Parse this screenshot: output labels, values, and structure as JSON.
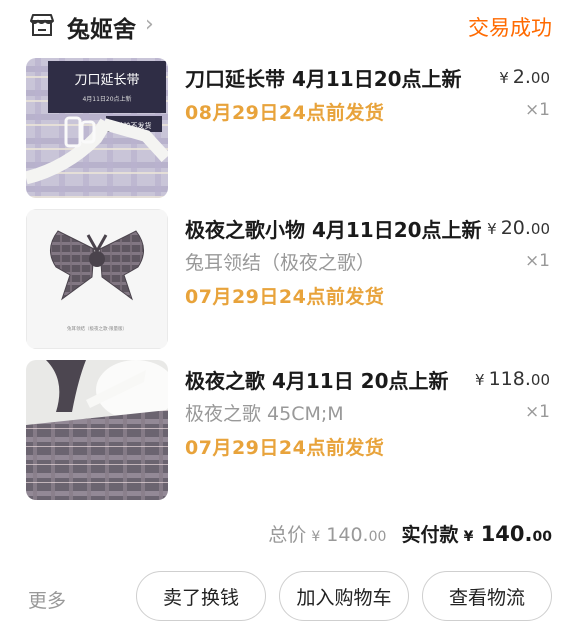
{
  "shop": {
    "name": "兔姬舍",
    "status": "交易成功"
  },
  "items": [
    {
      "title": "刀口延长带  4月11日20点上新",
      "spec": "",
      "shipping": "08月29日24点前发货",
      "price_currency": "¥",
      "price_int": "2.",
      "price_dec": "00",
      "qty": "×1",
      "image_text": {
        "title": "刀口延长带",
        "sub": "4月11日20点上新",
        "tag": "单拍不发货"
      }
    },
    {
      "title": "极夜之歌小物 4月11日20点上新",
      "spec": "兔耳领结（极夜之歌）",
      "shipping": "07月29日24点前发货",
      "price_currency": "¥",
      "price_int": "20.",
      "price_dec": "00",
      "qty": "×1",
      "image_text": {
        "caption": "兔耳领结（极夜之歌·限量版）"
      }
    },
    {
      "title": "极夜之歌   4月11日 20点上新",
      "spec": "极夜之歌    45CM;M",
      "shipping": "07月29日24点前发货",
      "price_currency": "¥",
      "price_int": "118.",
      "price_dec": "00",
      "qty": "×1"
    }
  ],
  "summary": {
    "total_label": "总价",
    "total_currency": "¥",
    "total_int": "140.",
    "total_dec": "00",
    "paid_label": "实付款",
    "paid_currency": "¥",
    "paid_int": "140.",
    "paid_dec": "00"
  },
  "actions": {
    "more": "更多",
    "sell": "卖了换钱",
    "add_cart": "加入购物车",
    "logistics": "查看物流"
  },
  "colors": {
    "status": "#ff6a00",
    "shipping": "#e8a33b"
  },
  "icons": {
    "shop": "shop-icon",
    "chevron": "chevron-right-icon"
  }
}
